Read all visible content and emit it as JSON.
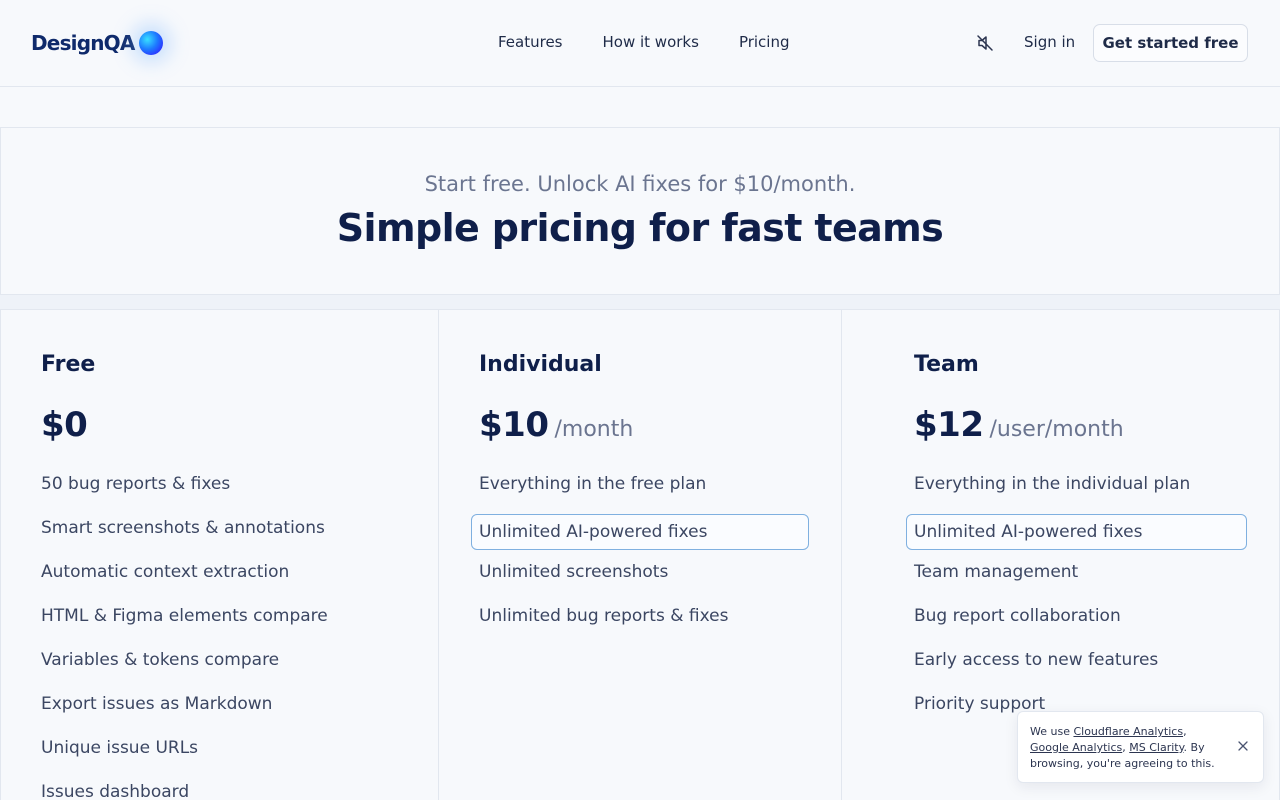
{
  "header": {
    "logo_text": "DesignQA",
    "nav": [
      "Features",
      "How it works",
      "Pricing"
    ],
    "sound_icon": "sound-muted-icon",
    "signin_label": "Sign in",
    "cta_label": "Get started free"
  },
  "hero": {
    "subtitle": "Start free. Unlock AI fixes for $10/month.",
    "title": "Simple pricing for fast teams"
  },
  "plans": [
    {
      "name": "Free",
      "price": "$0",
      "period": "",
      "features": [
        "50 bug reports & fixes",
        "Smart screenshots & annotations",
        "Automatic context extraction",
        "HTML & Figma elements compare",
        "Variables & tokens compare",
        "Export issues as Markdown",
        "Unique issue URLs",
        "Issues dashboard"
      ]
    },
    {
      "name": "Individual",
      "price": "$10",
      "period": "/month",
      "features": [
        "Everything in the free plan",
        "Unlimited AI-powered fixes",
        "Unlimited screenshots",
        "Unlimited bug reports & fixes"
      ],
      "highlighted_feature": "Unlimited AI-powered fixes"
    },
    {
      "name": "Team",
      "price": "$12",
      "period": "/user/month",
      "features": [
        "Everything in the individual plan",
        "Unlimited AI-powered fixes",
        "Team management",
        "Bug report collaboration",
        "Early access to new features",
        "Priority support"
      ],
      "highlighted_feature": "Unlimited AI-powered fixes"
    }
  ],
  "cookie": {
    "prefix": "We use ",
    "link1": "Cloudflare Analytics",
    "sep1": ", ",
    "link2": "Google Analytics",
    "sep2": ", ",
    "link3": "MS Clarity",
    "suffix": ". By browsing, you're agreeing to this.",
    "close_icon": "close-icon"
  },
  "colors": {
    "brand_navy": "#0f1f4a",
    "muted": "#6b7590",
    "highlight_border": "#7fb0e0",
    "background": "#f7f9fc"
  }
}
